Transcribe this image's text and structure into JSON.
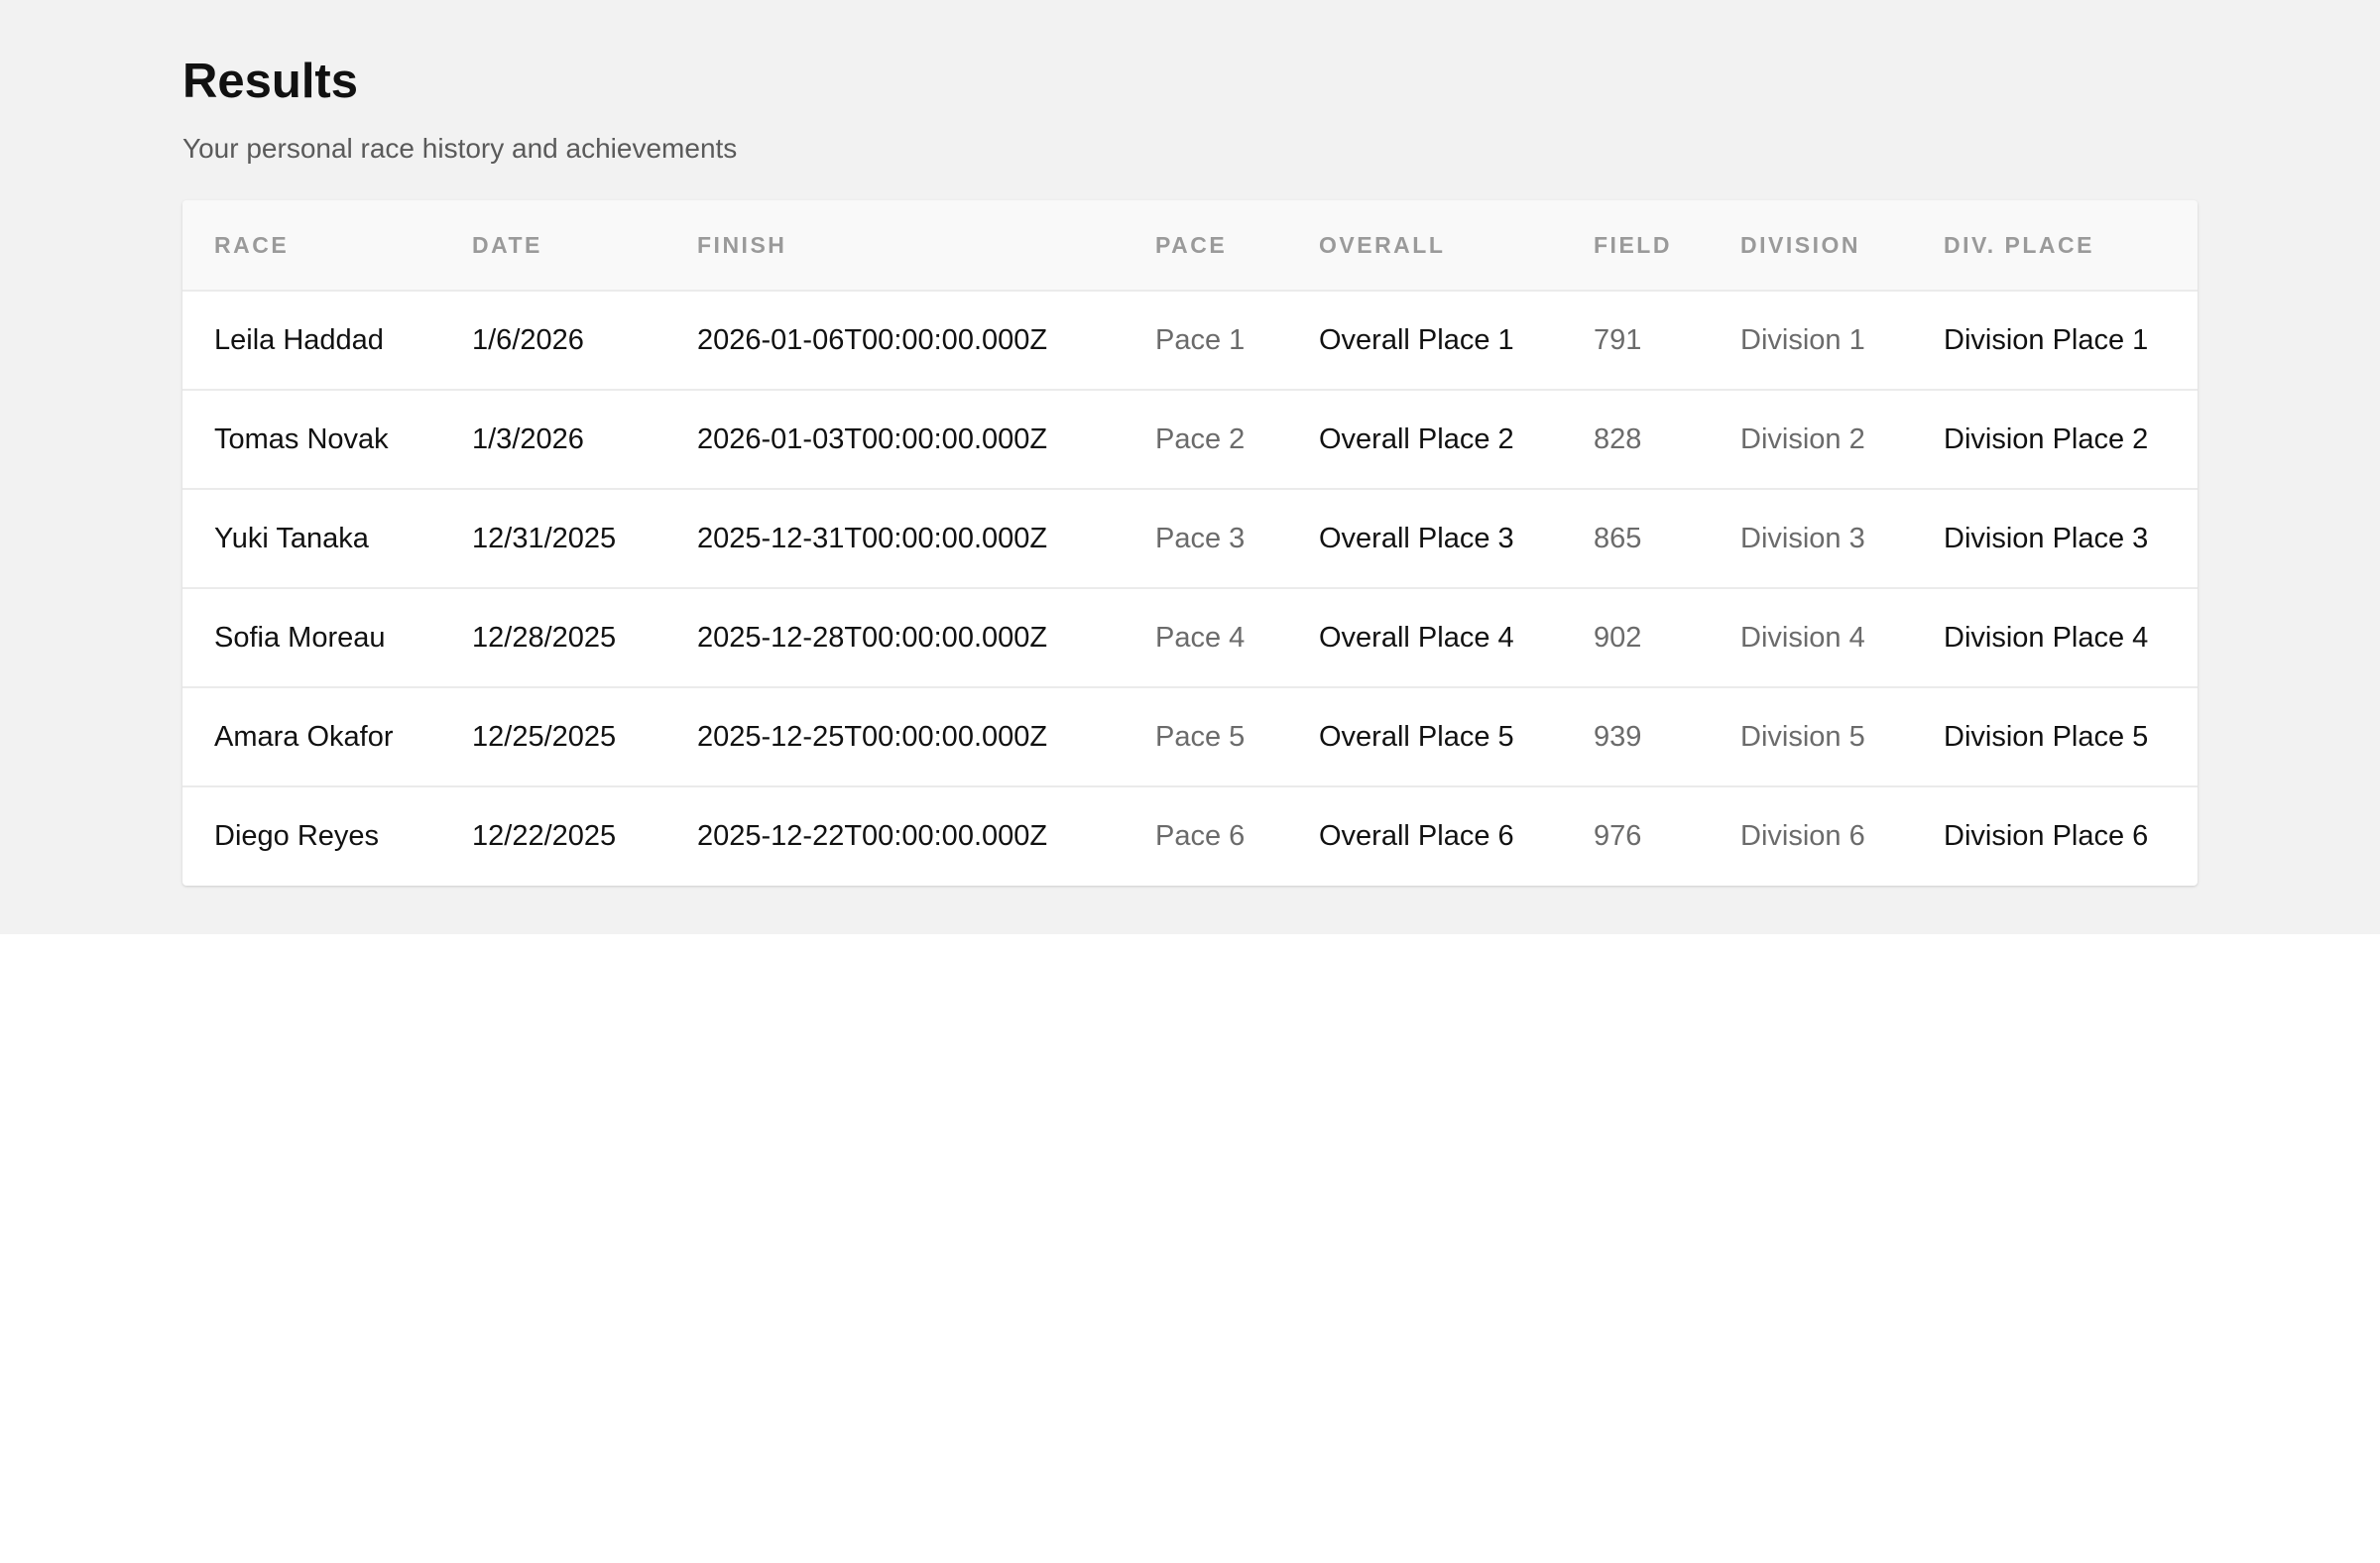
{
  "page": {
    "title": "Results",
    "subtitle": "Your personal race history and achievements"
  },
  "table": {
    "headers": {
      "race": "RACE",
      "date": "DATE",
      "finish": "FINISH",
      "pace": "PACE",
      "overall": "OVERALL",
      "field": "FIELD",
      "division": "DIVISION",
      "div_place": "DIV. PLACE"
    },
    "rows": [
      {
        "race": "Leila Haddad",
        "date": "1/6/2026",
        "finish": "2026-01-06T00:00:00.000Z",
        "pace": "Pace 1",
        "overall": "Overall Place 1",
        "field": "791",
        "division": "Division 1",
        "div_place": "Division Place 1"
      },
      {
        "race": "Tomas Novak",
        "date": "1/3/2026",
        "finish": "2026-01-03T00:00:00.000Z",
        "pace": "Pace 2",
        "overall": "Overall Place 2",
        "field": "828",
        "division": "Division 2",
        "div_place": "Division Place 2"
      },
      {
        "race": "Yuki Tanaka",
        "date": "12/31/2025",
        "finish": "2025-12-31T00:00:00.000Z",
        "pace": "Pace 3",
        "overall": "Overall Place 3",
        "field": "865",
        "division": "Division 3",
        "div_place": "Division Place 3"
      },
      {
        "race": "Sofia Moreau",
        "date": "12/28/2025",
        "finish": "2025-12-28T00:00:00.000Z",
        "pace": "Pace 4",
        "overall": "Overall Place 4",
        "field": "902",
        "division": "Division 4",
        "div_place": "Division Place 4"
      },
      {
        "race": "Amara Okafor",
        "date": "12/25/2025",
        "finish": "2025-12-25T00:00:00.000Z",
        "pace": "Pace 5",
        "overall": "Overall Place 5",
        "field": "939",
        "division": "Division 5",
        "div_place": "Division Place 5"
      },
      {
        "race": "Diego Reyes",
        "date": "12/22/2025",
        "finish": "2025-12-22T00:00:00.000Z",
        "pace": "Pace 6",
        "overall": "Overall Place 6",
        "field": "976",
        "division": "Division 6",
        "div_place": "Division Place 6"
      }
    ]
  }
}
